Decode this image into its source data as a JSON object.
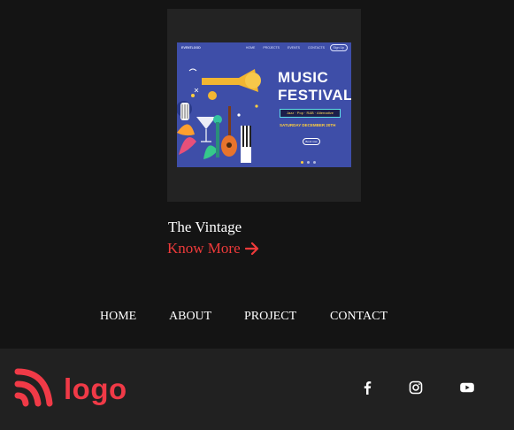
{
  "poster": {
    "brand": "EVENTLOOD",
    "nav_links": [
      "HOME",
      "PROJECTS",
      "EVENTS",
      "CONTACTS"
    ],
    "signup": "Sign Up",
    "title_line1": "MUSIC",
    "title_line2": "FESTIVAL",
    "genres": "Jazz · Pop · R&B · Alternative",
    "date": "SATURDAY DECEMBER 20TH",
    "button": "Book now"
  },
  "card": {
    "title": "The Vintage",
    "link_label": "Know More",
    "link_icon": "arrow-right-icon"
  },
  "nav": {
    "items": [
      "HOME",
      "ABOUT",
      "PROJECT",
      "CONTACT"
    ]
  },
  "footer": {
    "logo_text": "logo",
    "logo_icon": "signal-waves-icon",
    "social": [
      "facebook-icon",
      "instagram-icon",
      "youtube-icon"
    ]
  },
  "colors": {
    "background": "#141414",
    "footer_bg": "#212121",
    "accent": "#ee3a3a",
    "logo": "#f03a47",
    "poster_bg": "#3e4ea8"
  }
}
